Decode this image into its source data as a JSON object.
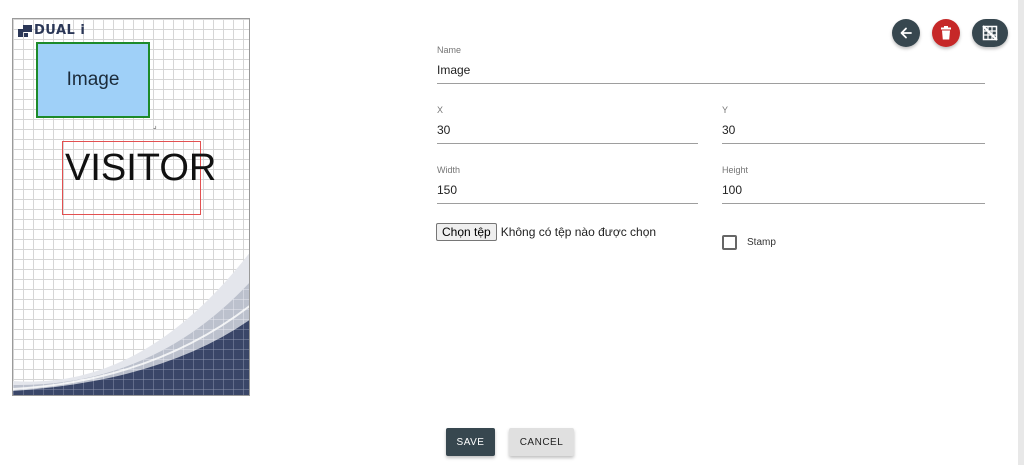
{
  "preview": {
    "logo_text": "DUAL i",
    "image_box_label": "Image",
    "text_box_label": "VISITOR",
    "colors": {
      "image_fill": "#9fd0f8",
      "image_border": "#1d8a2a",
      "text_border": "#e35050",
      "wave_dark": "#3a4668"
    }
  },
  "toolbar": {
    "back_icon": "arrow-left-icon",
    "delete_icon": "trash-icon",
    "grid_icon": "grid-off-icon"
  },
  "form": {
    "name": {
      "label": "Name",
      "value": "Image"
    },
    "x": {
      "label": "X",
      "value": "30"
    },
    "y": {
      "label": "Y",
      "value": "30"
    },
    "width": {
      "label": "Width",
      "value": "150"
    },
    "height": {
      "label": "Height",
      "value": "100"
    },
    "file": {
      "button_label": "Chọn tệp",
      "status": "Không có tệp nào được chọn"
    },
    "stamp": {
      "label": "Stamp",
      "checked": false
    }
  },
  "actions": {
    "save_label": "SAVE",
    "cancel_label": "CANCEL"
  }
}
